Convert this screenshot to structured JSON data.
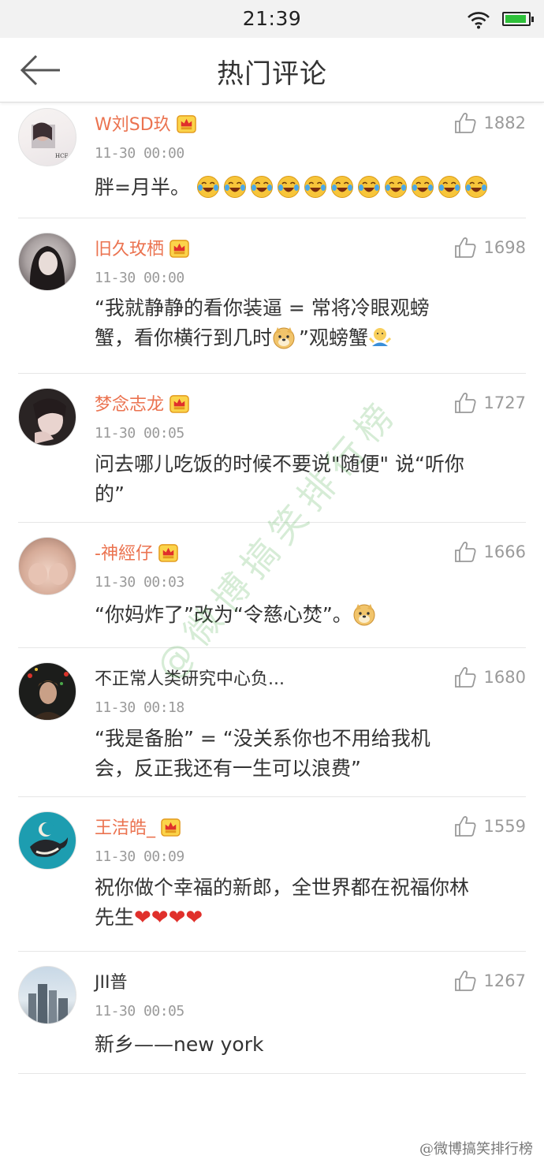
{
  "status_bar": {
    "time": "21:39"
  },
  "nav": {
    "title": "热门评论"
  },
  "comments": [
    {
      "username": "W刘SD玖",
      "vip": true,
      "time": "11-30 00:00",
      "likes": "1882",
      "text": "胖=月半。"
    },
    {
      "username": "旧久玫栖",
      "vip": true,
      "time": "11-30 00:00",
      "likes": "1698",
      "text_line1": "“我就静静的看你装逼 = 常将冷眼观螃",
      "text_line2": "蟹，看你横行到几时",
      "text_line2_b": "”观螃蟹"
    },
    {
      "username": "梦念志龙",
      "vip": true,
      "time": "11-30 00:05",
      "likes": "1727",
      "text_line1": "问去哪儿吃饭的时候不要说\"随便\"  说“听你",
      "text_line2": "的”"
    },
    {
      "username": "-神經仔",
      "vip": true,
      "time": "11-30 00:03",
      "likes": "1666",
      "text": "“你妈炸了”改为“令慈心焚”。"
    },
    {
      "username": "不正常人类研究中心负...",
      "vip": false,
      "time": "11-30 00:18",
      "likes": "1680",
      "text_line1": "“我是备胎” = “没关系你也不用给我机",
      "text_line2": "会，反正我还有一生可以浪费”"
    },
    {
      "username": "王洁皓_",
      "vip": true,
      "time": "11-30 00:09",
      "likes": "1559",
      "text_line1": "祝你做个幸福的新郎，全世界都在祝福你林",
      "text_line2": "先生"
    },
    {
      "username": "JII普",
      "vip": false,
      "time": "11-30 00:05",
      "likes": "1267",
      "text": "新乡——new york"
    }
  ],
  "watermark": "@微博搞笑排行榜",
  "bottom_watermark": "@微博搞笑排行榜",
  "colors": {
    "accent": "#eb7350",
    "like_gray": "#9a9a9a"
  },
  "icons": {
    "back": "back-arrow-icon",
    "like": "thumbs-up-icon",
    "vip": "crown-icon"
  }
}
